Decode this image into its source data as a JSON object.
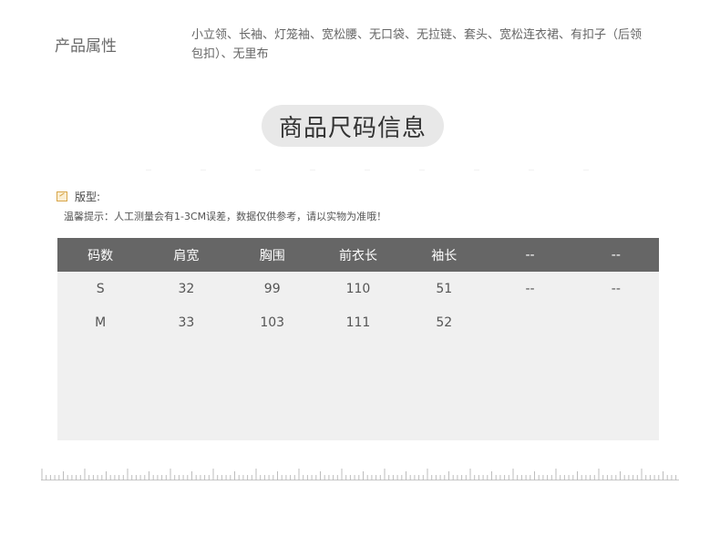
{
  "attributes": {
    "label": "产品属性",
    "value": "小立领、长袖、灯笼袖、宽松腰、无口袋、无拉链、套头、宽松连衣裙、有扣子（后领包扣）、无里布"
  },
  "section_title": "商品尺码信息",
  "fit": {
    "icon": "fit-pattern-icon",
    "label": "版型:"
  },
  "tip": "温馨提示：人工测量会有1-3CM误差，数据仅供参考，请以实物为准哦！",
  "size_table": {
    "headers": [
      "码数",
      "肩宽",
      "胸围",
      "前衣长",
      "袖长",
      "--",
      "--"
    ],
    "rows": [
      [
        "S",
        "32",
        "99",
        "110",
        "51",
        "--",
        "--"
      ],
      [
        "M",
        "33",
        "103",
        "111",
        "52",
        "",
        ""
      ]
    ]
  },
  "colors": {
    "header_bg": "#666666",
    "table_bg": "#f0f0f0",
    "title_pill_bg": "#e8e8e8",
    "icon_accent": "#d8a64a"
  }
}
